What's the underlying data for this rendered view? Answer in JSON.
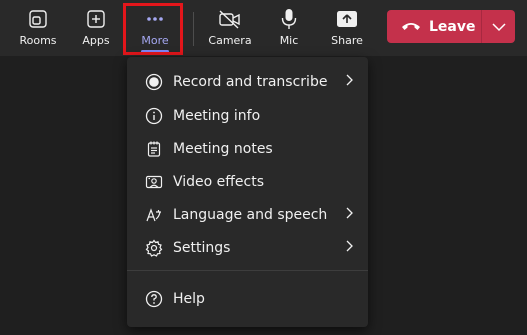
{
  "toolbar": {
    "rooms_label": "Rooms",
    "apps_label": "Apps",
    "more_label": "More",
    "camera_label": "Camera",
    "mic_label": "Mic",
    "share_label": "Share",
    "leave_label": "Leave"
  },
  "menu": {
    "items": [
      {
        "label": "Record and transcribe",
        "icon": "record-icon",
        "submenu": true
      },
      {
        "label": "Meeting info",
        "icon": "info-icon",
        "submenu": false
      },
      {
        "label": "Meeting notes",
        "icon": "notes-icon",
        "submenu": false
      },
      {
        "label": "Video effects",
        "icon": "video-effects-icon",
        "submenu": false
      },
      {
        "label": "Language and speech",
        "icon": "language-icon",
        "submenu": true
      },
      {
        "label": "Settings",
        "icon": "gear-icon",
        "submenu": true
      },
      {
        "label": "Help",
        "icon": "help-icon",
        "submenu": false
      }
    ]
  },
  "colors": {
    "leave": "#c4314b",
    "accent": "#7f85f5",
    "highlight": "#e3161b"
  }
}
